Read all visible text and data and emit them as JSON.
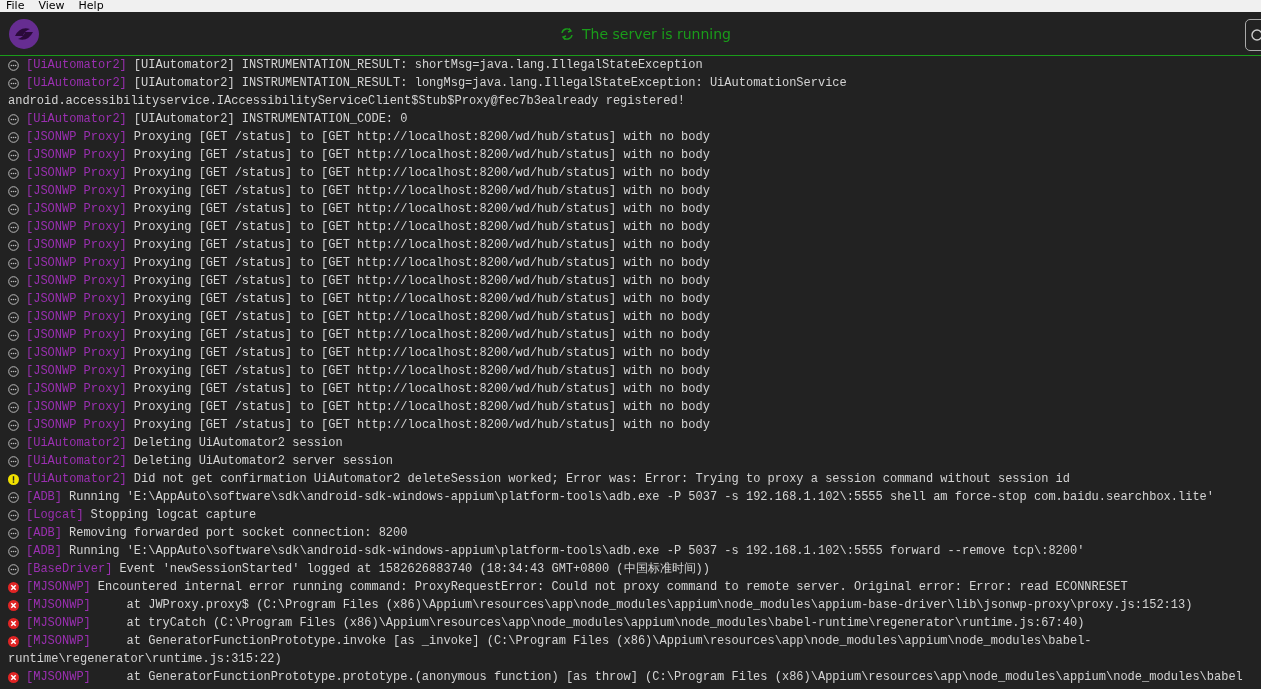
{
  "menu": [
    {
      "label": "File"
    },
    {
      "label": "View"
    },
    {
      "label": "Help"
    }
  ],
  "header": {
    "status": "The server is running"
  },
  "log": [
    {
      "kind": "info",
      "tag": "[UiAutomator2]",
      "text": "[UIAutomator2] INSTRUMENTATION_RESULT: shortMsg=java.lang.IllegalStateException"
    },
    {
      "kind": "info",
      "tag": "[UiAutomator2]",
      "text": "[UIAutomator2] INSTRUMENTATION_RESULT: longMsg=java.lang.IllegalStateException: UiAutomationService",
      "continued": "android.accessibilityservice.IAccessibilityServiceClient$Stub$Proxy@fec7b3ealready registered!"
    },
    {
      "kind": "info",
      "tag": "[UiAutomator2]",
      "text": "[UIAutomator2] INSTRUMENTATION_CODE: 0"
    },
    {
      "kind": "info",
      "tag": "[JSONWP Proxy]",
      "text": "Proxying [GET /status] to [GET http://localhost:8200/wd/hub/status] with no body"
    },
    {
      "kind": "info",
      "tag": "[JSONWP Proxy]",
      "text": "Proxying [GET /status] to [GET http://localhost:8200/wd/hub/status] with no body"
    },
    {
      "kind": "info",
      "tag": "[JSONWP Proxy]",
      "text": "Proxying [GET /status] to [GET http://localhost:8200/wd/hub/status] with no body"
    },
    {
      "kind": "info",
      "tag": "[JSONWP Proxy]",
      "text": "Proxying [GET /status] to [GET http://localhost:8200/wd/hub/status] with no body"
    },
    {
      "kind": "info",
      "tag": "[JSONWP Proxy]",
      "text": "Proxying [GET /status] to [GET http://localhost:8200/wd/hub/status] with no body"
    },
    {
      "kind": "info",
      "tag": "[JSONWP Proxy]",
      "text": "Proxying [GET /status] to [GET http://localhost:8200/wd/hub/status] with no body"
    },
    {
      "kind": "info",
      "tag": "[JSONWP Proxy]",
      "text": "Proxying [GET /status] to [GET http://localhost:8200/wd/hub/status] with no body"
    },
    {
      "kind": "info",
      "tag": "[JSONWP Proxy]",
      "text": "Proxying [GET /status] to [GET http://localhost:8200/wd/hub/status] with no body"
    },
    {
      "kind": "info",
      "tag": "[JSONWP Proxy]",
      "text": "Proxying [GET /status] to [GET http://localhost:8200/wd/hub/status] with no body"
    },
    {
      "kind": "info",
      "tag": "[JSONWP Proxy]",
      "text": "Proxying [GET /status] to [GET http://localhost:8200/wd/hub/status] with no body"
    },
    {
      "kind": "info",
      "tag": "[JSONWP Proxy]",
      "text": "Proxying [GET /status] to [GET http://localhost:8200/wd/hub/status] with no body"
    },
    {
      "kind": "info",
      "tag": "[JSONWP Proxy]",
      "text": "Proxying [GET /status] to [GET http://localhost:8200/wd/hub/status] with no body"
    },
    {
      "kind": "info",
      "tag": "[JSONWP Proxy]",
      "text": "Proxying [GET /status] to [GET http://localhost:8200/wd/hub/status] with no body"
    },
    {
      "kind": "info",
      "tag": "[JSONWP Proxy]",
      "text": "Proxying [GET /status] to [GET http://localhost:8200/wd/hub/status] with no body"
    },
    {
      "kind": "info",
      "tag": "[JSONWP Proxy]",
      "text": "Proxying [GET /status] to [GET http://localhost:8200/wd/hub/status] with no body"
    },
    {
      "kind": "info",
      "tag": "[JSONWP Proxy]",
      "text": "Proxying [GET /status] to [GET http://localhost:8200/wd/hub/status] with no body"
    },
    {
      "kind": "info",
      "tag": "[JSONWP Proxy]",
      "text": "Proxying [GET /status] to [GET http://localhost:8200/wd/hub/status] with no body"
    },
    {
      "kind": "info",
      "tag": "[UiAutomator2]",
      "text": "Deleting UiAutomator2 session"
    },
    {
      "kind": "info",
      "tag": "[UiAutomator2]",
      "text": "Deleting UiAutomator2 server session"
    },
    {
      "kind": "warn",
      "tag": "[UiAutomator2]",
      "text": "Did not get confirmation UiAutomator2 deleteSession worked; Error was: Error: Trying to proxy a session command without session id"
    },
    {
      "kind": "info",
      "tag": "[ADB]",
      "text": "Running 'E:\\AppAuto\\software\\sdk\\android-sdk-windows-appium\\platform-tools\\adb.exe -P 5037 -s 192.168.1.102\\:5555 shell am force-stop com.baidu.searchbox.lite'"
    },
    {
      "kind": "info",
      "tag": "[Logcat]",
      "text": "Stopping logcat capture"
    },
    {
      "kind": "info",
      "tag": "[ADB]",
      "text": "Removing forwarded port socket connection: 8200"
    },
    {
      "kind": "info",
      "tag": "[ADB]",
      "text": "Running 'E:\\AppAuto\\software\\sdk\\android-sdk-windows-appium\\platform-tools\\adb.exe -P 5037 -s 192.168.1.102\\:5555 forward --remove tcp\\:8200'"
    },
    {
      "kind": "info",
      "tag": "[BaseDriver]",
      "text": "Event 'newSessionStarted' logged at 1582626883740 (18:34:43 GMT+0800 (中国标准时间))"
    },
    {
      "kind": "error",
      "tag": "[MJSONWP]",
      "text": "Encountered internal error running command: ProxyRequestError: Could not proxy command to remote server. Original error: Error: read ECONNRESET"
    },
    {
      "kind": "error",
      "tag": "[MJSONWP]",
      "text": "    at JWProxy.proxy$ (C:\\Program Files (x86)\\Appium\\resources\\app\\node_modules\\appium\\node_modules\\appium-base-driver\\lib\\jsonwp-proxy\\proxy.js:152:13)"
    },
    {
      "kind": "error",
      "tag": "[MJSONWP]",
      "text": "    at tryCatch (C:\\Program Files (x86)\\Appium\\resources\\app\\node_modules\\appium\\node_modules\\babel-runtime\\regenerator\\runtime.js:67:40)"
    },
    {
      "kind": "error",
      "tag": "[MJSONWP]",
      "text": "    at GeneratorFunctionPrototype.invoke [as _invoke] (C:\\Program Files (x86)\\Appium\\resources\\app\\node_modules\\appium\\node_modules\\babel-",
      "continued": "runtime\\regenerator\\runtime.js:315:22)"
    },
    {
      "kind": "error",
      "tag": "[MJSONWP]",
      "text": "    at GeneratorFunctionPrototype.prototype.(anonymous function) [as throw] (C:\\Program Files (x86)\\Appium\\resources\\app\\node_modules\\appium\\node_modules\\babel"
    }
  ]
}
